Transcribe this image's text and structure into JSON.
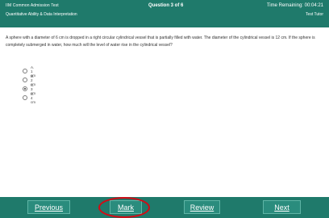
{
  "header": {
    "test_name": "IIM Common Admission Test",
    "section_name": "Quantitative Ability & Data Interpretation",
    "question_no": "Question 3 of 6",
    "timer": "Time Remaining: 00:04:21",
    "test_tools": "Test Tutor"
  },
  "question": {
    "text": "A sphere with a diameter of 6 cm is dropped in a right circular cylindrical vessel that is partially filled with water. The diameter of the cylindrical vessel is 12 cm. If the sphere is completely submerged in water, how much will the level of water rise in the cylindrical vessel?"
  },
  "options": [
    {
      "label": "A. 1 cm",
      "selected": false
    },
    {
      "label": "B. 2 cm",
      "selected": false
    },
    {
      "label": "C. 3 cm",
      "selected": true
    },
    {
      "label": "D. 4 cm",
      "selected": false
    }
  ],
  "footer": {
    "previous_label": "Previous",
    "mark_label": "Mark",
    "review_label": "Review",
    "next_label": "Next"
  },
  "colors": {
    "bar": "#1f7a6b",
    "button": "#2a8c7d",
    "highlight_circle": "#d40a14"
  }
}
